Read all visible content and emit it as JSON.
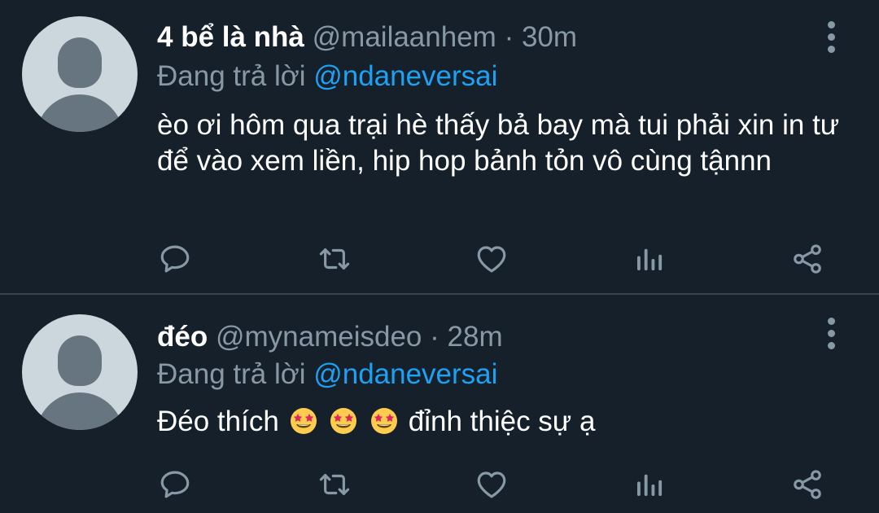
{
  "tweets": [
    {
      "display_name": "4 bể là nhà",
      "handle": "@mailaanhem",
      "separator": "·",
      "time": "30m",
      "reply_prefix": "Đang trả lời",
      "reply_to": "@ndaneversai",
      "text": "èo ơi hôm qua trại hè thấy bả bay mà tui phải xin in tư để vào xem liền, hip hop bảnh tỏn vô cùng tậnnn"
    },
    {
      "display_name": "đéo",
      "handle": "@mynameisdeo",
      "separator": "·",
      "time": "28m",
      "reply_prefix": "Đang trả lời",
      "reply_to": "@ndaneversai",
      "text_before": "Đéo thích",
      "emojis": [
        "star-struck",
        "star-struck",
        "star-struck"
      ],
      "text_after": "đỉnh thiệc sự ạ"
    }
  ],
  "icons": {
    "reply": "reply-icon",
    "retweet": "retweet-icon",
    "like": "heart-icon",
    "analytics": "analytics-icon",
    "share": "share-icon",
    "more": "more-vertical-icon"
  },
  "colors": {
    "background": "#15202b",
    "divider": "#38444d",
    "secondary_text": "#8899a6",
    "mention": "#1da1f2",
    "primary_text": "#ffffff"
  }
}
